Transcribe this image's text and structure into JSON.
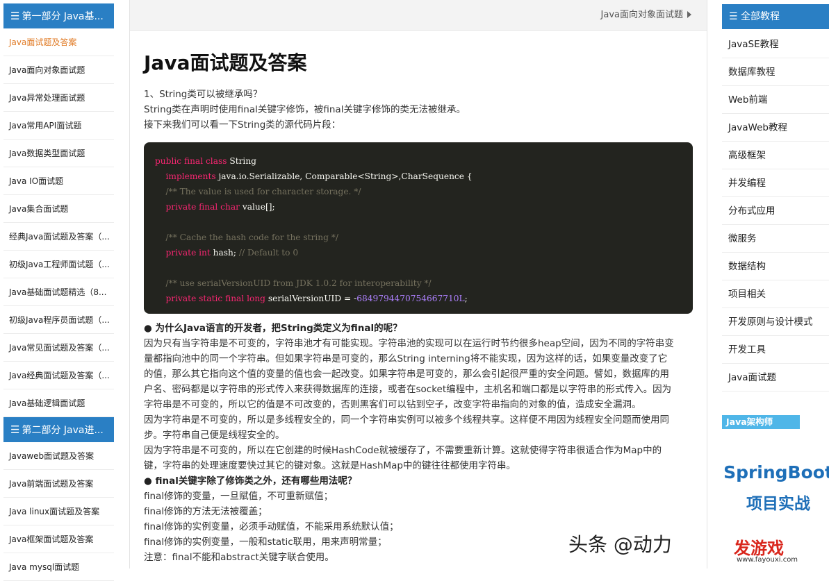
{
  "left_sidebar": {
    "section1_title": "第一部分 Java基...",
    "section1_items": [
      "Java面试题及答案",
      "Java面向对象面试题",
      "Java异常处理面试题",
      "Java常用API面试题",
      "Java数据类型面试题",
      "Java IO面试题",
      "Java集合面试题",
      "经典Java面试题及答案（...",
      "初级Java工程师面试题（...",
      "Java基础面试题精选（8...",
      "初级Java程序员面试题（...",
      "Java常见面试题及答案（...",
      "Java经典面试题及答案（...",
      "Java基础逻辑面试题"
    ],
    "section2_title": "第二部分 Java进...",
    "section2_items": [
      "Javaweb面试题及答案",
      "Java前端面试题及答案",
      "Java linux面试题及答案",
      "Java框架面试题及答案",
      "Java mysql面试题"
    ]
  },
  "breadcrumb": {
    "next_link": "Java面向对象面试题"
  },
  "article": {
    "title": "Java面试题及答案",
    "intro": [
      "1、String类可以被继承吗？",
      "String类在声明时使用final关键字修饰，被final关键字修饰的类无法被继承。",
      "接下来我们可以看一下String类的源代码片段："
    ],
    "code": {
      "l1_kw": "public final class",
      "l1_rest": " String",
      "l2_kw": "implements",
      "l2_rest": " java.io.Serializable, Comparable<String>,CharSequence {",
      "l3_cm": "/** The value is used for character storage. */",
      "l4_kw": "private final char",
      "l4_rest": " value[];",
      "l6_cm": "/** Cache the hash code for the string */",
      "l7_kw": "private int",
      "l7_rest": " hash; ",
      "l7_cm": "// Default to 0",
      "l9_cm": "/** use serialVersionUID from JDK 1.0.2 for interoperability */",
      "l10_kw": "private static final long",
      "l10_rest": " serialVersionUID = -",
      "l10_num": "6849794470754667710L",
      "l10_end": ";"
    },
    "body": [
      {
        "b": true,
        "t": "● 为什么Java语言的开发者，把String类定义为final的呢？"
      },
      {
        "b": false,
        "t": "因为只有当字符串是不可变的，字符串池才有可能实现。字符串池的实现可以在运行时节约很多heap空间，因为不同的字符串变"
      },
      {
        "b": false,
        "t": "量都指向池中的同一个字符串。但如果字符串是可变的，那么String interning将不能实现，因为这样的话，如果变量改变了它"
      },
      {
        "b": false,
        "t": "的值，那么其它指向这个值的变量的值也会一起改变。如果字符串是可变的，那么会引起很严重的安全问题。譬如，数据库的用"
      },
      {
        "b": false,
        "t": "户名、密码都是以字符串的形式传入来获得数据库的连接，或者在socket编程中，主机名和端口都是以字符串的形式传入。因为"
      },
      {
        "b": false,
        "t": "字符串是不可变的，所以它的值是不可改变的，否则黑客们可以钻到空子，改变字符串指向的对象的值，造成安全漏洞。"
      },
      {
        "b": false,
        "t": "因为字符串是不可变的，所以是多线程安全的，同一个字符串实例可以被多个线程共享。这样便不用因为线程安全问题而使用同"
      },
      {
        "b": false,
        "t": "步。字符串自己便是线程安全的。"
      },
      {
        "b": false,
        "t": "因为字符串是不可变的，所以在它创建的时候HashCode就被缓存了，不需要重新计算。这就使得字符串很适合作为Map中的"
      },
      {
        "b": false,
        "t": "键，字符串的处理速度要快过其它的键对象。这就是HashMap中的键往往都使用字符串。"
      },
      {
        "b": true,
        "t": "● final关键字除了修饰类之外，还有哪些用法呢？"
      },
      {
        "b": false,
        "t": "final修饰的变量，一旦赋值，不可重新赋值；"
      },
      {
        "b": false,
        "t": "final修饰的方法无法被覆盖；"
      },
      {
        "b": false,
        "t": "final修饰的实例变量，必须手动赋值，不能采用系统默认值；"
      },
      {
        "b": false,
        "t": "final修饰的实例变量，一般和static联用，用来声明常量；"
      },
      {
        "b": false,
        "t": "注意：final不能和abstract关键字联合使用。"
      }
    ]
  },
  "right_sidebar": {
    "title": "全部教程",
    "items": [
      "JavaSE教程",
      "数据库教程",
      "Web前端",
      "JavaWeb教程",
      "高级框架",
      "并发编程",
      "分布式应用",
      "微服务",
      "数据结构",
      "项目相关",
      "开发原则与设计模式",
      "开发工具",
      "Java面试题"
    ],
    "ad": {
      "tag": "Java架构师",
      "line1": "SpringBoot",
      "line2": "项目实战"
    }
  },
  "watermark": {
    "text": "头条 @动力",
    "logo": "发游戏",
    "logo_url": "www.fayouxi.com"
  }
}
